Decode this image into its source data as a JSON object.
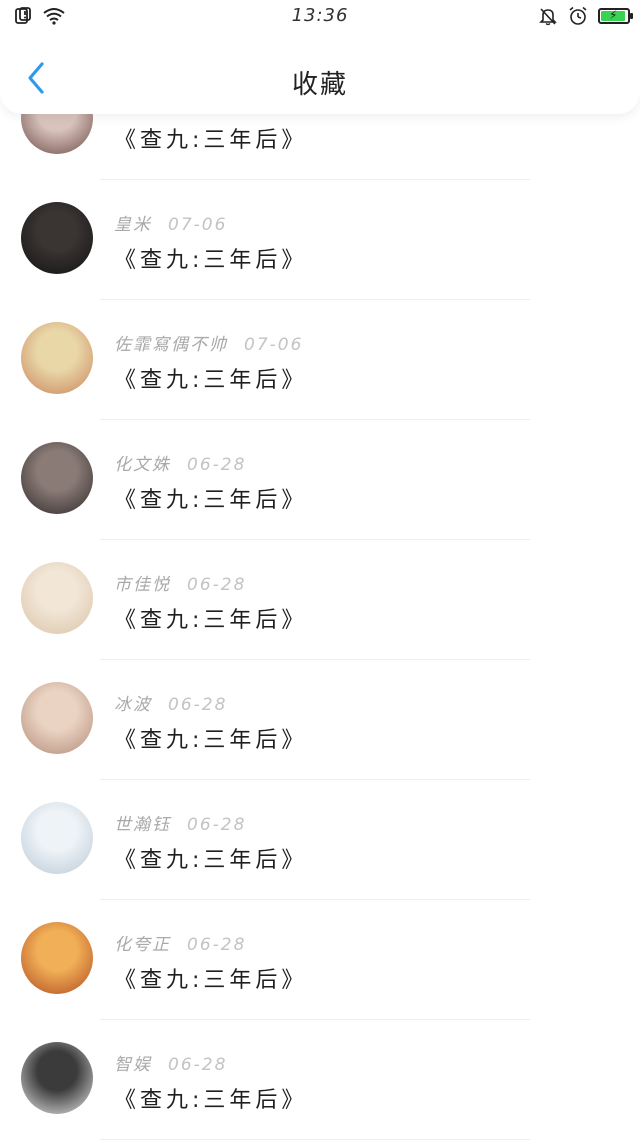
{
  "status_bar": {
    "time": "13:36"
  },
  "header": {
    "title": "收藏"
  },
  "items": [
    {
      "name": "",
      "date": "",
      "title": "《查九:三年后》",
      "avatar_colors": [
        "#d9c3bd",
        "#6b4a45"
      ]
    },
    {
      "name": "皇米",
      "date": "07-06",
      "title": "《查九:三年后》",
      "avatar_colors": [
        "#3a3433",
        "#111111"
      ]
    },
    {
      "name": "佐霏寫偶不帅",
      "date": "07-06",
      "title": "《查九:三年后》",
      "avatar_colors": [
        "#e9d7a8",
        "#c9845b"
      ]
    },
    {
      "name": "化文姝",
      "date": "06-28",
      "title": "《查九:三年后》",
      "avatar_colors": [
        "#8a7b76",
        "#2f2a2a"
      ]
    },
    {
      "name": "市佳悦",
      "date": "06-28",
      "title": "《查九:三年后》",
      "avatar_colors": [
        "#f2e6d7",
        "#d9c3a6"
      ]
    },
    {
      "name": "冰波",
      "date": "06-28",
      "title": "《查九:三年后》",
      "avatar_colors": [
        "#ead3c2",
        "#b38a78"
      ]
    },
    {
      "name": "世瀚钰",
      "date": "06-28",
      "title": "《查九:三年后》",
      "avatar_colors": [
        "#eef3f7",
        "#b9c9d6"
      ]
    },
    {
      "name": "化夸正",
      "date": "06-28",
      "title": "《查九:三年后》",
      "avatar_colors": [
        "#f1b057",
        "#b04a20"
      ]
    },
    {
      "name": "智娱",
      "date": "06-28",
      "title": "《查九:三年后》",
      "avatar_colors": [
        "#3b3b3b",
        "#e9e9e9"
      ]
    }
  ]
}
